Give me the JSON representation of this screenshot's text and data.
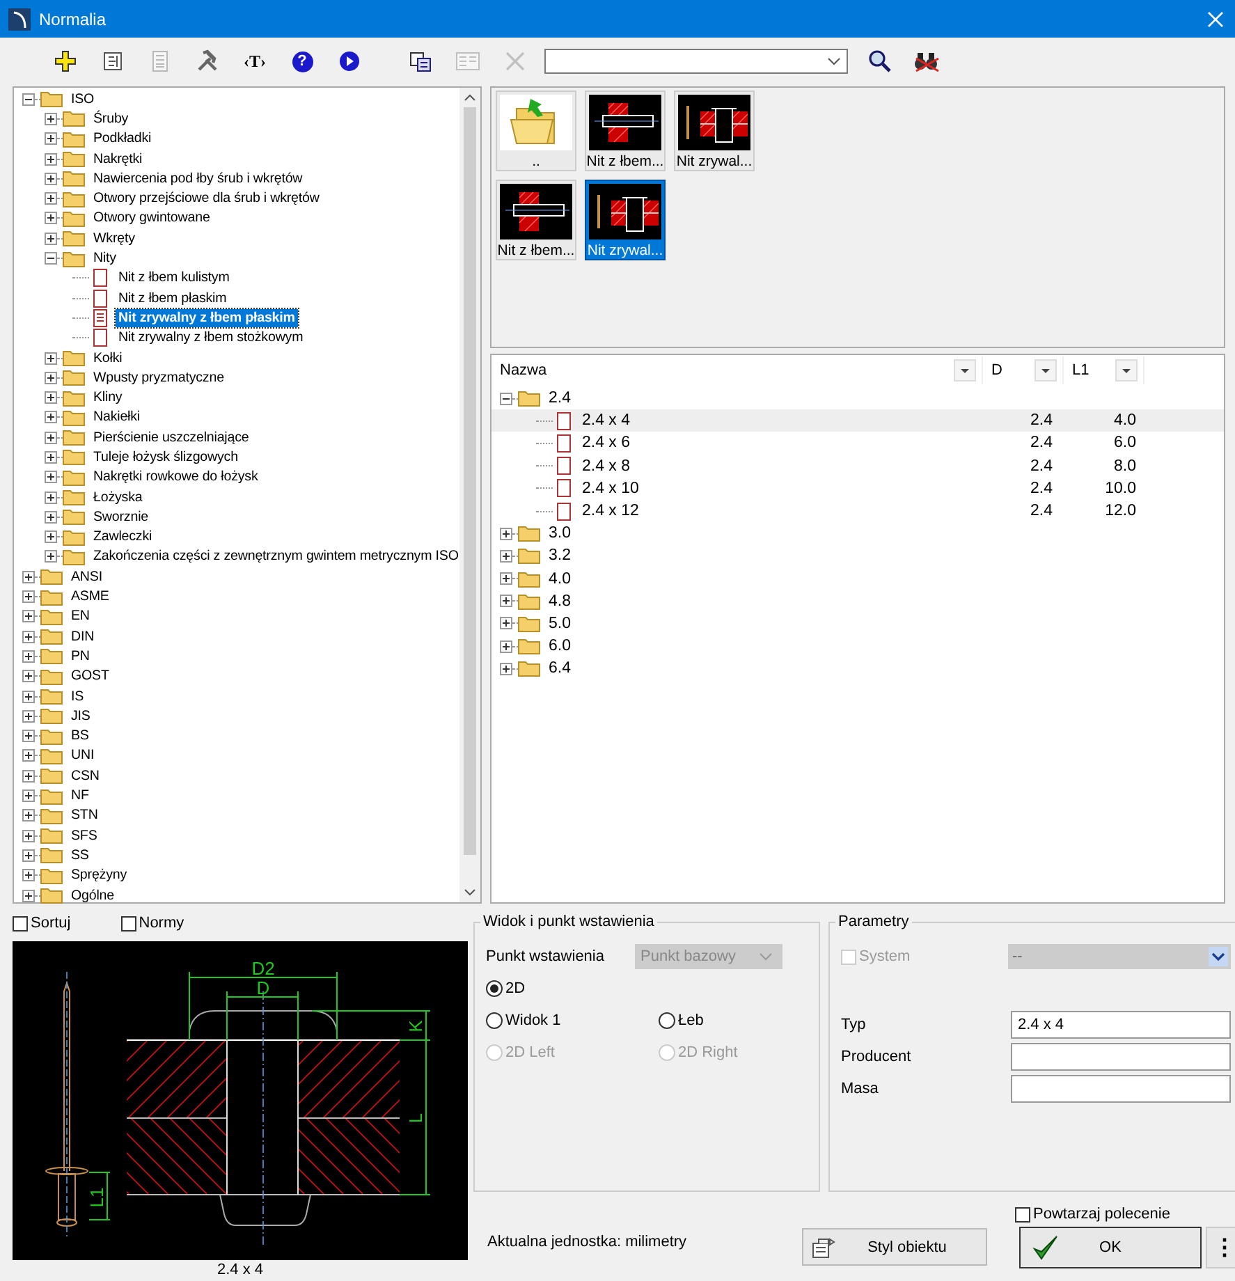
{
  "window": {
    "title": "Normalia"
  },
  "toolbar": [
    {
      "kind": "add",
      "disabled": false
    },
    {
      "kind": "properties",
      "disabled": false
    },
    {
      "kind": "list",
      "disabled": true
    },
    {
      "kind": "tools",
      "disabled": false
    },
    {
      "kind": "text",
      "label": "‹T›",
      "disabled": false
    },
    {
      "kind": "help",
      "label": "?",
      "disabled": false
    },
    {
      "kind": "play",
      "disabled": false
    },
    {
      "kind": "copy",
      "disabled": false
    },
    {
      "kind": "panel",
      "disabled": true
    },
    {
      "kind": "delete",
      "disabled": true
    },
    {
      "kind": "combo"
    },
    {
      "kind": "search",
      "disabled": false
    },
    {
      "kind": "binoculars",
      "disabled": false
    }
  ],
  "tree": {
    "nodes": [
      {
        "label": "ISO",
        "kind": "folder",
        "expanded": true,
        "selected": false,
        "children": [
          {
            "label": "Śruby",
            "kind": "folder",
            "expanded": false,
            "selected": false
          },
          {
            "label": "Podkładki",
            "kind": "folder",
            "expanded": false,
            "selected": false
          },
          {
            "label": "Nakrętki",
            "kind": "folder",
            "expanded": false,
            "selected": false
          },
          {
            "label": "Nawiercenia pod łby śrub i wkrętów",
            "kind": "folder",
            "expanded": false,
            "selected": false
          },
          {
            "label": "Otwory przejściowe dla śrub i wkrętów",
            "kind": "folder",
            "expanded": false,
            "selected": false
          },
          {
            "label": "Otwory gwintowane",
            "kind": "folder",
            "expanded": false,
            "selected": false
          },
          {
            "label": "Wkręty",
            "kind": "folder",
            "expanded": false,
            "selected": false
          },
          {
            "label": "Nity",
            "kind": "folder",
            "expanded": true,
            "selected": false,
            "children": [
              {
                "label": "Nit z łbem kulistym",
                "kind": "item",
                "selected": false
              },
              {
                "label": "Nit z łbem płaskim",
                "kind": "item",
                "selected": false
              },
              {
                "label": "Nit zrywalny z łbem płaskim",
                "kind": "item",
                "selected": true
              },
              {
                "label": "Nit zrywalny z łbem stożkowym",
                "kind": "item",
                "selected": false
              }
            ]
          },
          {
            "label": "Kołki",
            "kind": "folder",
            "expanded": false,
            "selected": false
          },
          {
            "label": "Wpusty pryzmatyczne",
            "kind": "folder",
            "expanded": false,
            "selected": false
          },
          {
            "label": "Kliny",
            "kind": "folder",
            "expanded": false,
            "selected": false
          },
          {
            "label": "Nakiełki",
            "kind": "folder",
            "expanded": false,
            "selected": false
          },
          {
            "label": "Pierścienie uszczelniające",
            "kind": "folder",
            "expanded": false,
            "selected": false
          },
          {
            "label": "Tuleje łożysk ślizgowych",
            "kind": "folder",
            "expanded": false,
            "selected": false
          },
          {
            "label": "Nakrętki rowkowe do łożysk",
            "kind": "folder",
            "expanded": false,
            "selected": false
          },
          {
            "label": "Łożyska",
            "kind": "folder",
            "expanded": false,
            "selected": false
          },
          {
            "label": "Sworznie",
            "kind": "folder",
            "expanded": false,
            "selected": false
          },
          {
            "label": "Zawleczki",
            "kind": "folder",
            "expanded": false,
            "selected": false
          },
          {
            "label": "Zakończenia części z zewnętrznym gwintem metrycznym ISO",
            "kind": "folder",
            "expanded": false,
            "selected": false
          }
        ]
      },
      {
        "label": "ANSI",
        "kind": "folder",
        "expanded": false,
        "selected": false
      },
      {
        "label": "ASME",
        "kind": "folder",
        "expanded": false,
        "selected": false
      },
      {
        "label": "EN",
        "kind": "folder",
        "expanded": false,
        "selected": false
      },
      {
        "label": "DIN",
        "kind": "folder",
        "expanded": false,
        "selected": false
      },
      {
        "label": "PN",
        "kind": "folder",
        "expanded": false,
        "selected": false
      },
      {
        "label": "GOST",
        "kind": "folder",
        "expanded": false,
        "selected": false
      },
      {
        "label": "IS",
        "kind": "folder",
        "expanded": false,
        "selected": false
      },
      {
        "label": "JIS",
        "kind": "folder",
        "expanded": false,
        "selected": false
      },
      {
        "label": "BS",
        "kind": "folder",
        "expanded": false,
        "selected": false
      },
      {
        "label": "UNI",
        "kind": "folder",
        "expanded": false,
        "selected": false
      },
      {
        "label": "CSN",
        "kind": "folder",
        "expanded": false,
        "selected": false
      },
      {
        "label": "NF",
        "kind": "folder",
        "expanded": false,
        "selected": false
      },
      {
        "label": "STN",
        "kind": "folder",
        "expanded": false,
        "selected": false
      },
      {
        "label": "SFS",
        "kind": "folder",
        "expanded": false,
        "selected": false
      },
      {
        "label": "SS",
        "kind": "folder",
        "expanded": false,
        "selected": false
      },
      {
        "label": "Sprężyny",
        "kind": "folder",
        "expanded": false,
        "selected": false
      },
      {
        "label": "Ogólne",
        "kind": "folder",
        "expanded": false,
        "selected": false
      }
    ]
  },
  "thumbnails": [
    {
      "kind": "parent",
      "label": "..",
      "selected": false
    },
    {
      "kind": "flat-rivet",
      "label": "Nit z łbem...",
      "selected": false
    },
    {
      "kind": "blind-rivet",
      "label": "Nit zrywal...",
      "selected": false
    },
    {
      "kind": "flat-rivet",
      "label": "Nit z łbem...",
      "selected": false
    },
    {
      "kind": "blind-rivet",
      "label": "Nit zrywal...",
      "selected": true
    }
  ],
  "table": {
    "columns": [
      "Nazwa",
      "D",
      "L1"
    ],
    "rows": [
      {
        "label": "2.4",
        "expanded": true,
        "selected": false,
        "children": [
          {
            "name": "2.4 x 4",
            "d": "2.4",
            "l1": "4.0",
            "selected": true
          },
          {
            "name": "2.4 x 6",
            "d": "2.4",
            "l1": "6.0",
            "selected": false
          },
          {
            "name": "2.4 x 8",
            "d": "2.4",
            "l1": "8.0",
            "selected": false
          },
          {
            "name": "2.4 x 10",
            "d": "2.4",
            "l1": "10.0",
            "selected": false
          },
          {
            "name": "2.4 x 12",
            "d": "2.4",
            "l1": "12.0",
            "selected": false
          }
        ]
      },
      {
        "label": "3.0",
        "expanded": false,
        "selected": false
      },
      {
        "label": "3.2",
        "expanded": false,
        "selected": false
      },
      {
        "label": "4.0",
        "expanded": false,
        "selected": false
      },
      {
        "label": "4.8",
        "expanded": false,
        "selected": false
      },
      {
        "label": "5.0",
        "expanded": false,
        "selected": false
      },
      {
        "label": "6.0",
        "expanded": false,
        "selected": false
      },
      {
        "label": "6.4",
        "expanded": false,
        "selected": false
      }
    ]
  },
  "options": [
    {
      "label": "Sortuj",
      "checked": false
    },
    {
      "label": "Normy",
      "checked": false
    }
  ],
  "preview": {
    "labels": {
      "d2": "D2",
      "d": "D",
      "k": "K",
      "l": "L",
      "l1": "L1"
    },
    "caption": "2.4 x 4"
  },
  "view_group": {
    "title": "Widok i punkt wstawienia",
    "insertion_label": "Punkt wstawienia",
    "insertion_value": "Punkt bazowy",
    "insertion_disabled": true,
    "radios": [
      {
        "label": "2D",
        "selected": true,
        "disabled": false
      },
      {
        "label": "Widok 1",
        "selected": false,
        "disabled": false
      },
      {
        "label": "Łeb",
        "selected": false,
        "disabled": false
      },
      {
        "label": "2D Left",
        "selected": false,
        "disabled": true
      },
      {
        "label": "2D Right",
        "selected": false,
        "disabled": true
      }
    ]
  },
  "params_group": {
    "title": "Parametry",
    "system": {
      "label": "System",
      "checked": false,
      "disabled": true
    },
    "system_value": "--",
    "fields": [
      {
        "label": "Typ",
        "value": "2.4 x 4"
      },
      {
        "label": "Producent"
      },
      {
        "label": "Masa"
      }
    ]
  },
  "unit_text": "Aktualna jednostka: milimetry",
  "style_button": "Styl obiektu",
  "repeat": {
    "label": "Powtarzaj polecenie",
    "checked": false
  },
  "ok_button": "OK",
  "more_button": "⋮"
}
